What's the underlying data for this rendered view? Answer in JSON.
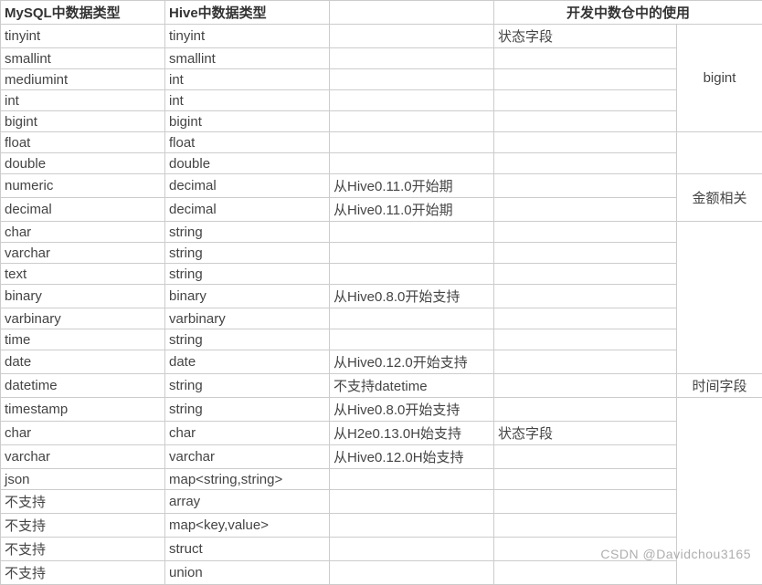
{
  "headers": {
    "col1": "MySQL中数据类型",
    "col2": "Hive中数据类型",
    "col45": "开发中数仓中的使用"
  },
  "rows": [
    {
      "mysql": "tinyint",
      "hive": "tinyint",
      "note": "",
      "use": "状态字段"
    },
    {
      "mysql": "smallint",
      "hive": "smallint",
      "note": "",
      "use": ""
    },
    {
      "mysql": "mediumint",
      "hive": "int",
      "note": "",
      "use": ""
    },
    {
      "mysql": "int",
      "hive": "int",
      "note": "",
      "use": ""
    },
    {
      "mysql": "bigint",
      "hive": "bigint",
      "note": "",
      "use": ""
    },
    {
      "mysql": "float",
      "hive": "float",
      "note": "",
      "use": ""
    },
    {
      "mysql": "double",
      "hive": "double",
      "note": "",
      "use": ""
    },
    {
      "mysql": "numeric",
      "hive": "decimal",
      "note": "从Hive0.11.0开始期",
      "use": ""
    },
    {
      "mysql": "decimal",
      "hive": "decimal",
      "note": "从Hive0.11.0开始期",
      "use": ""
    },
    {
      "mysql": "char",
      "hive": "string",
      "note": "",
      "use": ""
    },
    {
      "mysql": "varchar",
      "hive": "string",
      "note": "",
      "use": ""
    },
    {
      "mysql": "text",
      "hive": "string",
      "note": "",
      "use": ""
    },
    {
      "mysql": "binary",
      "hive": "binary",
      "note": "从Hive0.8.0开始支持",
      "use": ""
    },
    {
      "mysql": "varbinary",
      "hive": "varbinary",
      "note": "",
      "use": ""
    },
    {
      "mysql": "time",
      "hive": "string",
      "note": "",
      "use": ""
    },
    {
      "mysql": "date",
      "hive": "date",
      "note": "从Hive0.12.0开始支持",
      "use": ""
    },
    {
      "mysql": "datetime",
      "hive": "string",
      "note": "不支持datetime",
      "use": ""
    },
    {
      "mysql": "timestamp",
      "hive": "string",
      "note": "从Hive0.8.0开始支持",
      "use": ""
    },
    {
      "mysql": "char",
      "hive": "char",
      "note": "从H2e0.13.0H始支持",
      "use": "状态字段"
    },
    {
      "mysql": "varchar",
      "hive": "varchar",
      "note": "从Hive0.12.0H始支持",
      "use": ""
    },
    {
      "mysql": "json",
      "hive": "map<string,string>",
      "note": "",
      "use": ""
    },
    {
      "mysql": "不支持",
      "hive": "array",
      "note": "",
      "use": ""
    },
    {
      "mysql": "不支持",
      "hive": "map<key,value>",
      "note": "",
      "use": ""
    },
    {
      "mysql": "不支持",
      "hive": "struct",
      "note": "",
      "use": ""
    },
    {
      "mysql": "不支持",
      "hive": "union",
      "note": "",
      "use": ""
    }
  ],
  "merged": {
    "col5_group1": "bigint",
    "col5_group2": "金额相关",
    "col5_group3": "时间字段"
  },
  "watermark": "CSDN @Davidchou3165"
}
